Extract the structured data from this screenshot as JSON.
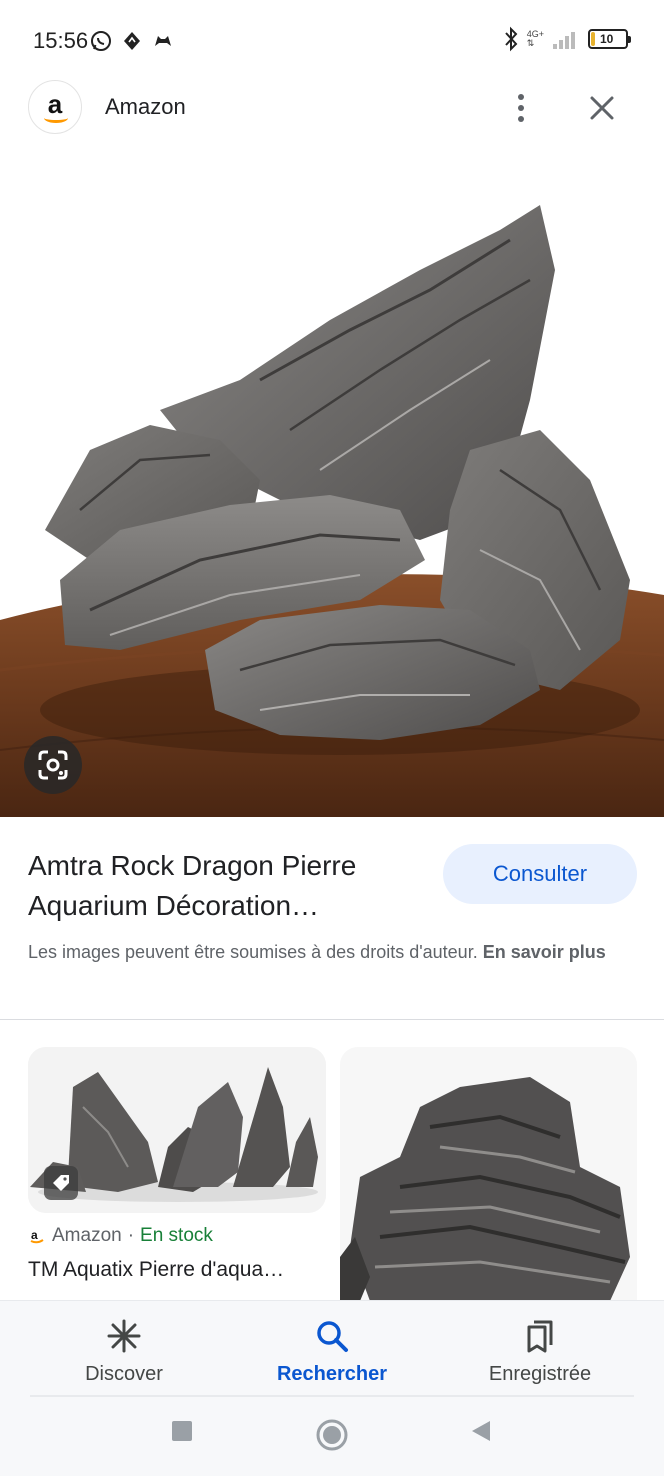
{
  "status_bar": {
    "time": "15:56",
    "battery_level": 10,
    "battery_label": "10",
    "network_label": "4G+"
  },
  "header": {
    "site_logo_letter": "a",
    "site_name": "Amazon"
  },
  "result": {
    "title": "Amtra Rock Dragon Pierre Aquarium Décoration…",
    "visit_label": "Consulter",
    "copyright_text": "Les images peuvent être soumises à des droits d'auteur.",
    "learn_more_label": "En savoir plus"
  },
  "related": [
    {
      "source": "Amazon",
      "separator": "·",
      "availability": "En stock",
      "title": "TM Aquatix Pierre d'aqua…"
    }
  ],
  "bottom_nav": {
    "items": [
      {
        "label": "Discover",
        "icon": "asterisk-icon",
        "active": false
      },
      {
        "label": "Rechercher",
        "icon": "search-icon",
        "active": true
      },
      {
        "label": "Enregistrée",
        "icon": "saved-collections-icon",
        "active": false
      }
    ]
  },
  "colors": {
    "accent": "#0b57d0",
    "visit_button_bg": "#e8f0fe",
    "in_stock": "#188038",
    "brand_amazon_orange": "#ff9900",
    "wood_table": "#6b3a1d",
    "rock_gray": "#6f6d6b"
  }
}
